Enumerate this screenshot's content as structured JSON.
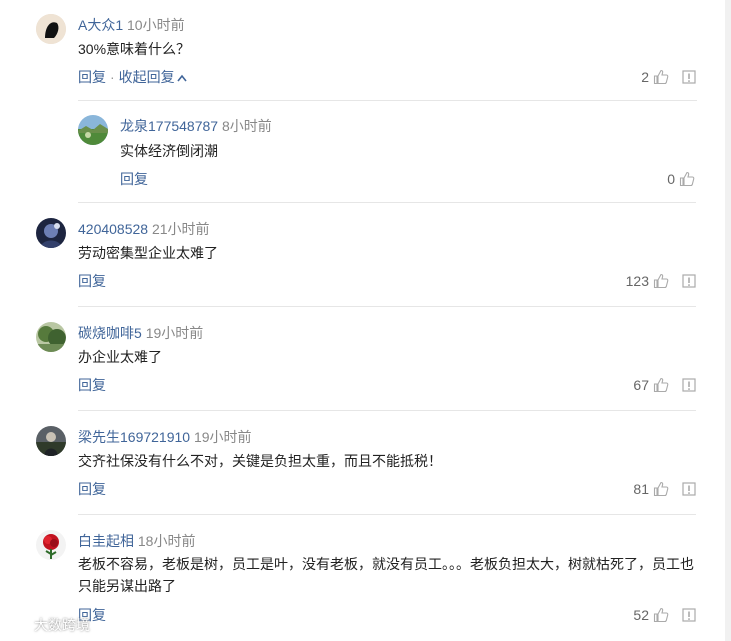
{
  "comments": [
    {
      "user": "A大众1",
      "time": "10小时前",
      "text": "30%意味着什么？",
      "reply_label": "回复",
      "collapse_label": "收起回复",
      "likes": "2",
      "replies": [
        {
          "user": "龙泉177548787",
          "time": "8小时前",
          "text": "实体经济倒闭潮",
          "reply_label": "回复",
          "likes": "0"
        }
      ]
    },
    {
      "user": "420408528",
      "time": "21小时前",
      "text": "劳动密集型企业太难了",
      "reply_label": "回复",
      "likes": "123"
    },
    {
      "user": "碳烧咖啡5",
      "time": "19小时前",
      "text": "办企业太难了",
      "reply_label": "回复",
      "likes": "67"
    },
    {
      "user": "梁先生169721910",
      "time": "19小时前",
      "text": "交齐社保没有什么不对，关键是负担太重，而且不能抵税！",
      "reply_label": "回复",
      "likes": "81"
    },
    {
      "user": "白圭起相",
      "time": "18小时前",
      "text": "老板不容易，老板是树，员工是叶，没有老板，就没有员工。。。老板负担太大，树就枯死了，员工也只能另谋出路了",
      "reply_label": "回复",
      "likes": "52"
    }
  ],
  "watermark": "大数跨境",
  "icons": {
    "like": "thumbs-up-icon",
    "report": "report-icon",
    "collapse": "chevron-up-icon"
  },
  "colors": {
    "username": "#406599",
    "action": "#406599",
    "muted": "#888888"
  }
}
